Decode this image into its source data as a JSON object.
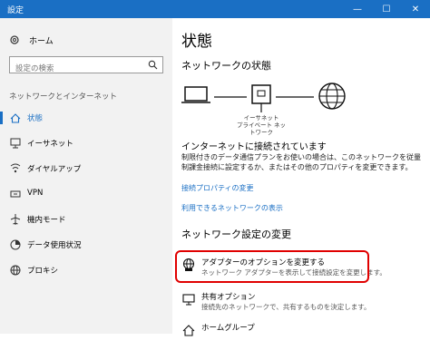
{
  "window": {
    "title": "設定"
  },
  "sidebar": {
    "home_label": "ホーム",
    "search_placeholder": "設定の検索",
    "section_header": "ネットワークとインターネット",
    "items": [
      {
        "label": "状態",
        "icon": "home-network-icon",
        "active": true
      },
      {
        "label": "イーサネット",
        "icon": "ethernet-icon"
      },
      {
        "label": "ダイヤルアップ",
        "icon": "dialup-icon"
      },
      {
        "label": "VPN",
        "icon": "vpn-icon"
      },
      {
        "label": "機内モード",
        "icon": "airplane-icon"
      },
      {
        "label": "データ使用状況",
        "icon": "data-usage-icon"
      },
      {
        "label": "プロキシ",
        "icon": "globe-icon"
      }
    ]
  },
  "main": {
    "title": "状態",
    "network_status_heading": "ネットワークの状態",
    "diagram": {
      "label_line1": "イーサネット",
      "label_line2": "プライベート ネットワーク"
    },
    "connected_text": "インターネットに接続されています",
    "description": "制限付きのデータ通信プランをお使いの場合は、このネットワークを従量制課金接続に設定するか、またはその他のプロパティを変更できます。",
    "links": {
      "change_properties": "接続プロパティの変更",
      "show_networks": "利用できるネットワークの表示"
    },
    "settings_heading": "ネットワーク設定の変更",
    "options": [
      {
        "title": "アダプターのオプションを変更する",
        "desc": "ネットワーク アダプターを表示して接続設定を変更します。"
      },
      {
        "title": "共有オプション",
        "desc": "接続先のネットワークで、共有するものを決定します。"
      },
      {
        "title": "ホームグループ",
        "desc": ""
      }
    ]
  },
  "colors": {
    "accent": "#1a6fc4",
    "highlight": "#e00000"
  }
}
